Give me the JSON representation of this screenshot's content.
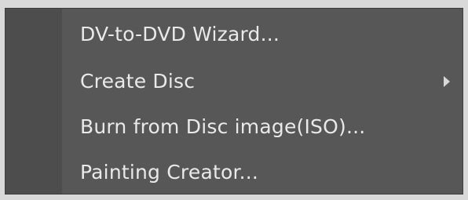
{
  "menu": {
    "items": [
      {
        "label": "DV-to-DVD Wizard...",
        "has_submenu": false
      },
      {
        "label": "Create Disc",
        "has_submenu": true
      },
      {
        "label": "Burn from Disc image(ISO)...",
        "has_submenu": false
      },
      {
        "label": "Painting Creator...",
        "has_submenu": false
      }
    ],
    "colors": {
      "background": "#575757",
      "gutter": "#4d4d4d",
      "text": "#e9e9e9"
    },
    "icons": {
      "submenu_arrow": "chevron-right-icon"
    }
  }
}
